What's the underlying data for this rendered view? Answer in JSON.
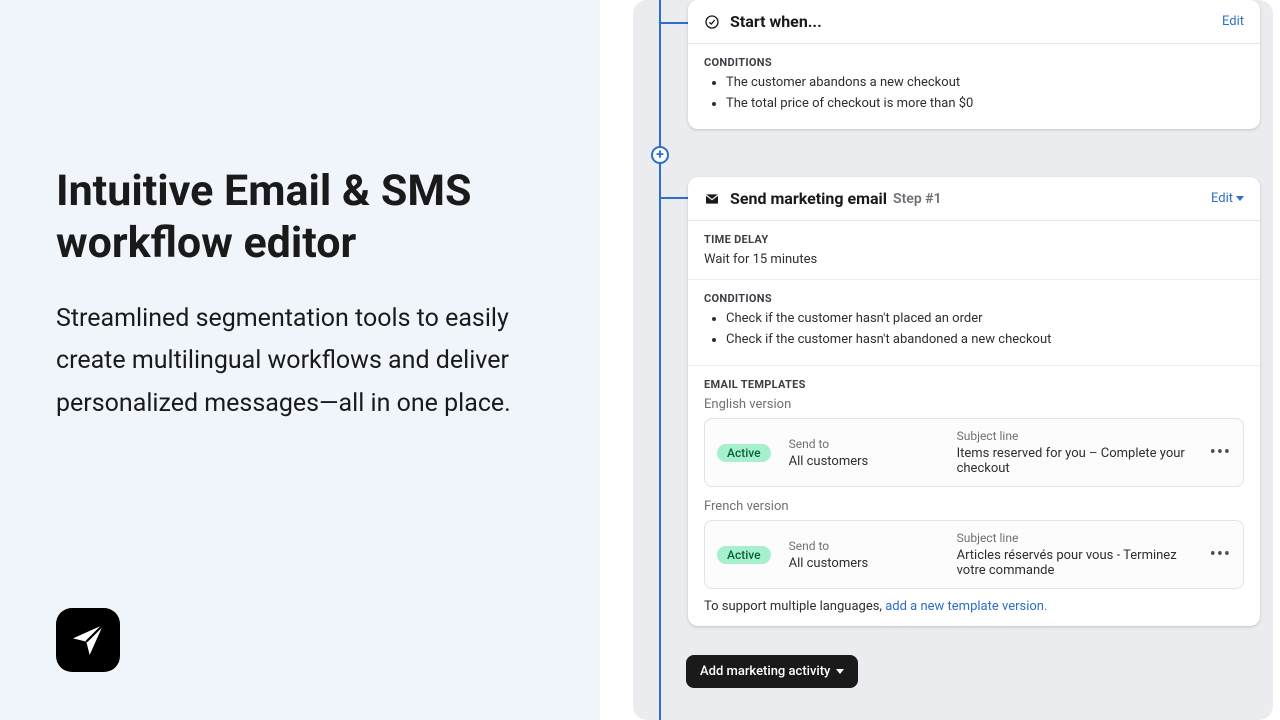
{
  "hero": {
    "title": "Intuitive Email & SMS workflow editor",
    "subtitle": "Streamlined segmentation tools to easily create multilingual workflows and deliver personalized messages—all in one place."
  },
  "workflow": {
    "start": {
      "title": "Start when...",
      "edit_label": "Edit",
      "conditions_heading": "CONDITIONS",
      "conditions": [
        "The customer abandons a new checkout",
        "The total price of checkout is more than $0"
      ]
    },
    "step": {
      "title": "Send marketing email",
      "step_tag": "Step #1",
      "edit_label": "Edit",
      "time_delay_heading": "TIME DELAY",
      "time_delay_text": "Wait for 15 minutes",
      "conditions_heading": "CONDITIONS",
      "conditions": [
        "Check if the customer hasn't placed an order",
        "Check if the customer hasn't abandoned a new checkout"
      ],
      "templates_heading": "EMAIL TEMPLATES",
      "templates": [
        {
          "lang_label": "English version",
          "status": "Active",
          "send_to_label": "Send to",
          "send_to_value": "All customers",
          "subject_label": "Subject line",
          "subject_value": "Items reserved for you – Complete your checkout"
        },
        {
          "lang_label": "French version",
          "status": "Active",
          "send_to_label": "Send to",
          "send_to_value": "All customers",
          "subject_label": "Subject line",
          "subject_value": "Articles réservés pour vous - Terminez votre commande"
        }
      ],
      "multi_lang_prefix": "To support multiple languages, ",
      "multi_lang_link": "add a new template version."
    },
    "add_activity_label": "Add marketing activity"
  }
}
